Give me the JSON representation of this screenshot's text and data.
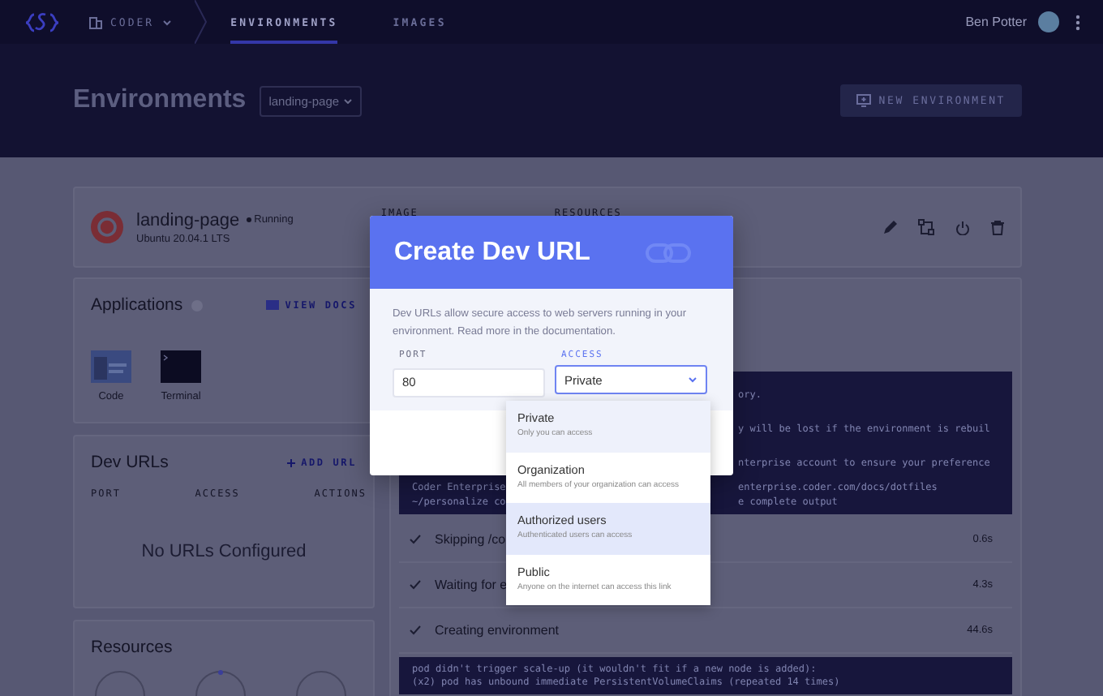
{
  "nav": {
    "org": "CODER",
    "tabs": [
      {
        "label": "ENVIRONMENTS",
        "selected": true
      },
      {
        "label": "IMAGES",
        "selected": false
      }
    ],
    "user": "Ben Potter"
  },
  "header": {
    "title": "Environments",
    "environment_select": "landing-page",
    "new_button": "NEW ENVIRONMENT"
  },
  "environment": {
    "name": "landing-page",
    "status": "Running",
    "os": "Ubuntu 20.04.1 LTS",
    "meta_labels": [
      "IMAGE",
      "RESOURCES"
    ]
  },
  "applications": {
    "title": "Applications",
    "docs_link": "VIEW DOCS",
    "apps": [
      {
        "label": "Code",
        "kind": "editor"
      },
      {
        "label": "Terminal",
        "kind": "terminal"
      }
    ]
  },
  "dev_urls": {
    "title": "Dev URLs",
    "add_button": "ADD URL",
    "columns": [
      "PORT",
      "ACCESS",
      "ACTIONS"
    ],
    "empty": "No URLs Configured"
  },
  "resources": {
    "title": "Resources"
  },
  "build_log": {
    "terminal_1": [
      {
        "end": "ory."
      },
      {
        "end": "y will be lost if the environment is rebuil"
      },
      {
        "end": "nterprise account to ensure your preference"
      },
      {
        "start": "Coder Enterprise",
        "end": "enterprise.coder.com/docs/dotfiles"
      },
      {
        "start": "~/personalize co",
        "end": "e complete output"
      }
    ],
    "steps": [
      {
        "label": "Skipping /co",
        "time": "0.6s",
        "done": true
      },
      {
        "label": "Waiting for e",
        "time": "4.3s",
        "done": true
      },
      {
        "label": "Creating environment",
        "time": "44.6s",
        "done": true
      }
    ],
    "terminal_2": [
      "pod didn't trigger scale-up (it wouldn't fit if a new node is added):",
      "(x2) pod has unbound immediate PersistentVolumeClaims (repeated 14 times)"
    ]
  },
  "modal": {
    "title": "Create Dev URL",
    "description": "Dev URLs allow secure access to web servers running in your environment. Read more in the documentation.",
    "port_label": "PORT",
    "port_value": "80",
    "access_label": "ACCESS",
    "access_value": "Private",
    "options": [
      {
        "label": "Private",
        "description": "Only you can access",
        "selected": true,
        "highlighted": false
      },
      {
        "label": "Organization",
        "description": "All members of your organization can access",
        "selected": false,
        "highlighted": false
      },
      {
        "label": "Authorized users",
        "description": "Authenticated users can access",
        "selected": false,
        "highlighted": true
      },
      {
        "label": "Public",
        "description": "Anyone on the internet can access this link",
        "selected": false,
        "highlighted": false
      }
    ]
  }
}
